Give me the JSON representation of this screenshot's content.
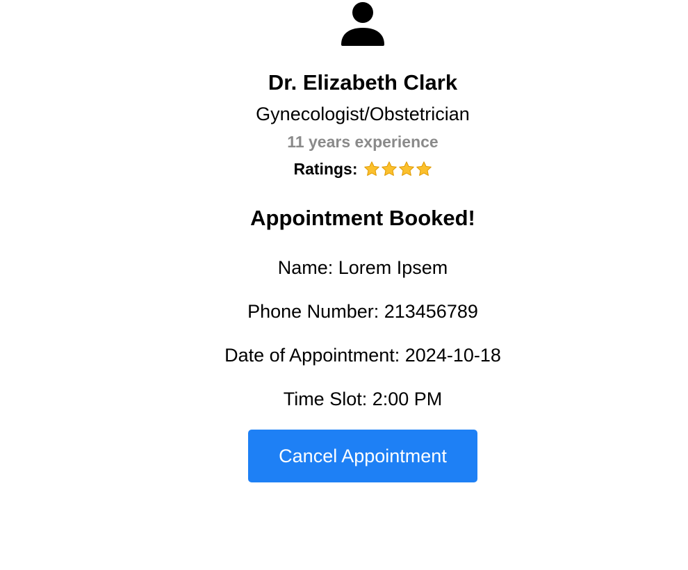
{
  "doctor": {
    "name": "Dr. Elizabeth Clark",
    "specialty": "Gynecologist/Obstetrician",
    "experience": "11 years experience",
    "ratings_label": "Ratings:",
    "rating_stars": 4,
    "star_icon": "star-icon",
    "avatar_icon": "user-avatar-icon"
  },
  "booking": {
    "heading": "Appointment Booked!",
    "name": "Name: Lorem Ipsem",
    "phone": "Phone Number: 213456789",
    "date": "Date of Appointment: 2024-10-18",
    "time": "Time Slot: 2:00 PM",
    "cancel_label": "Cancel Appointment"
  },
  "colors": {
    "primary_button": "#1e80f5",
    "muted_text": "#8a8a8a",
    "star_fill": "#fbc02d"
  }
}
